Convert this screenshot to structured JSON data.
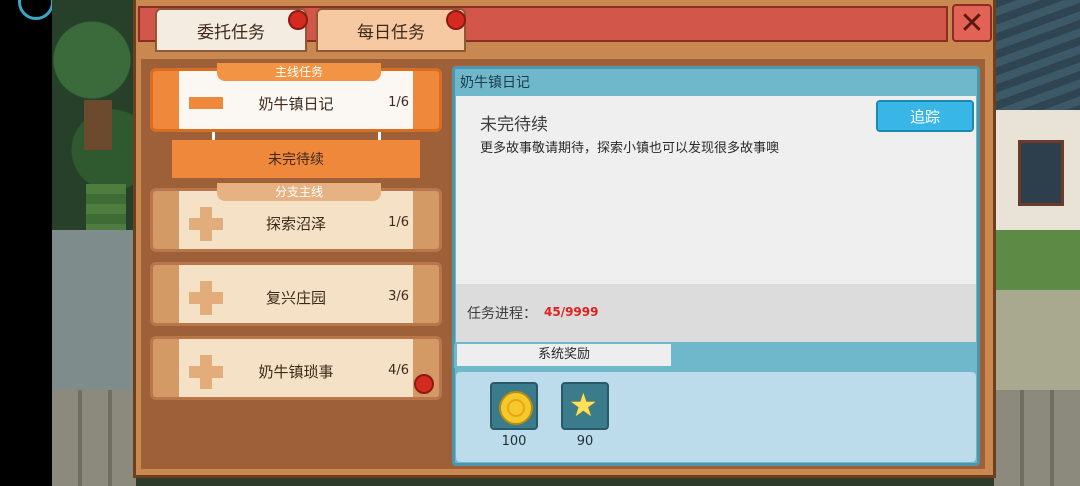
{
  "tabs": [
    {
      "label": "委托任务",
      "selected": true,
      "has_notification": true
    },
    {
      "label": "每日任务",
      "selected": false,
      "has_notification": true
    }
  ],
  "close_icon": "close-icon",
  "quests": [
    {
      "category": "主线任务",
      "name": "奶牛镇日记",
      "progress": "1/6",
      "active": true,
      "icon": "minus-icon"
    },
    {
      "category": "分支主线",
      "name": "探索沼泽",
      "progress": "1/6",
      "active": false,
      "icon": "plus-icon"
    },
    {
      "category": "",
      "name": "复兴庄园",
      "progress": "3/6",
      "active": false,
      "icon": "plus-icon"
    },
    {
      "category": "",
      "name": "奶牛镇琐事",
      "progress": "4/6",
      "active": false,
      "icon": "plus-icon",
      "has_notification": true
    }
  ],
  "active_substatus": "未完待续",
  "detail": {
    "title": "奶牛镇日记",
    "heading": "未完待续",
    "description": "更多故事敬请期待，探索小镇也可以发现很多故事噢",
    "track_label": "追踪",
    "progress_label": "任务进程：",
    "progress_value": "45/9999"
  },
  "rewards": {
    "tab_label": "系统奖励",
    "items": [
      {
        "icon": "coin-icon",
        "count": "100"
      },
      {
        "icon": "star-icon",
        "count": "90"
      }
    ]
  },
  "colors": {
    "accent_orange": "#f0883c",
    "track_blue": "#38b7e6",
    "notify_red": "#d52a1f",
    "progress_red": "#e02020"
  }
}
